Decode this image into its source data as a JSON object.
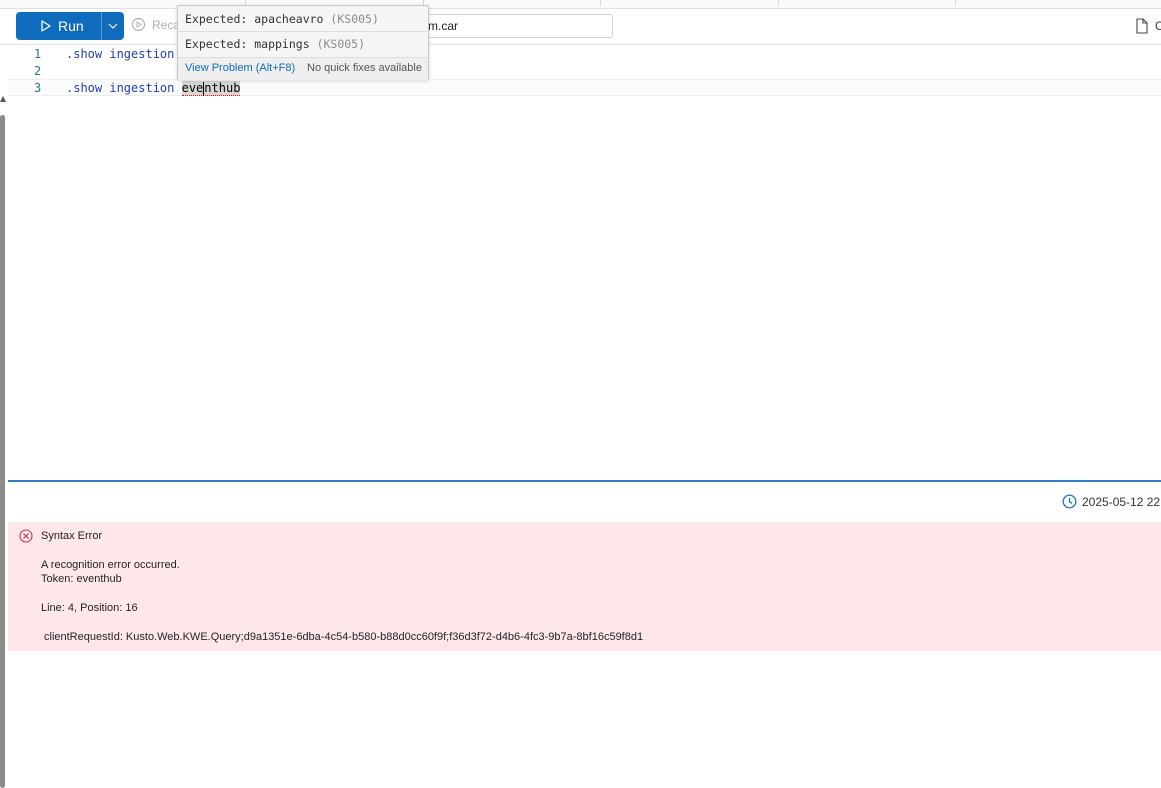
{
  "toolbar": {
    "run_label": "Run",
    "recall_label": "Reca",
    "cluster_value": "m.car",
    "file_label": "C"
  },
  "editor": {
    "lines": [
      {
        "number": "1",
        "keyword": ".show ingestion",
        "rest": ""
      },
      {
        "number": "2",
        "keyword": "",
        "rest": ""
      },
      {
        "number": "3",
        "keyword": ".show ingestion",
        "selected_a": "eve",
        "selected_b": "nthub"
      }
    ]
  },
  "hover": {
    "items": [
      {
        "text": "Expected: apacheavro",
        "code": "(KS005)"
      },
      {
        "text": "Expected: mappings",
        "code": "(KS005)"
      }
    ],
    "view_problem": "View Problem (Alt+F8)",
    "no_fixes": "No quick fixes available"
  },
  "results": {
    "timestamp": "2025-05-12 22",
    "error": {
      "title": "Syntax Error",
      "message": "A recognition error occurred.",
      "token": "Token: eventhub",
      "location": "Line: 4, Position: 16",
      "client_request_id": "clientRequestId: Kusto.Web.KWE.Query;d9a1351e-6dba-4c54-b580-b88d0cc60f9f;f36d3f72-d4b6-4fc3-9b7a-8bf16c59f8d1"
    }
  },
  "colors": {
    "accent": "#0f6cbd",
    "error_bg": "#fde7e9",
    "error_icon": "#c4314b"
  }
}
